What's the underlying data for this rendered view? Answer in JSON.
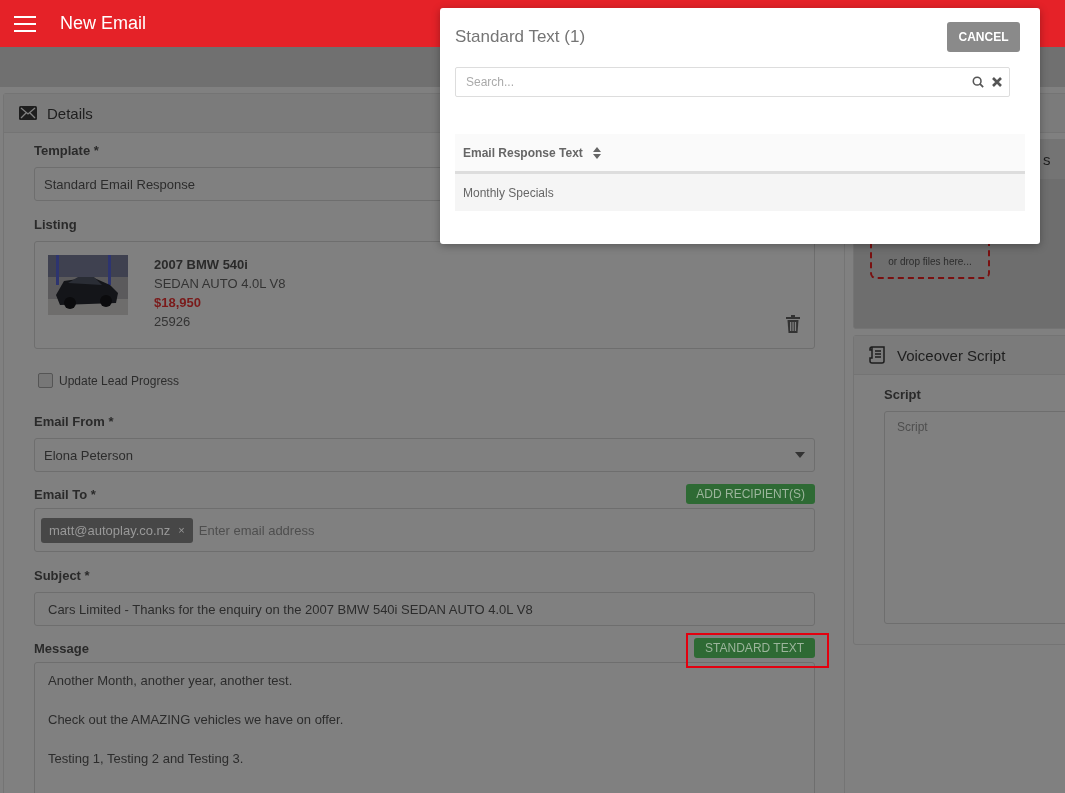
{
  "header": {
    "title": "New Email"
  },
  "details": {
    "title": "Details",
    "template": {
      "label": "Template *",
      "value": "Standard Email Response"
    },
    "listing": {
      "label": "Listing",
      "title": "2007 BMW 540i",
      "subtitle": "SEDAN AUTO 4.0L V8",
      "price": "$18,950",
      "stock": "25926"
    },
    "update_lead_progress": {
      "label": "Update Lead Progress",
      "checked": false
    },
    "email_from": {
      "label": "Email From *",
      "value": "Elona Peterson"
    },
    "email_to": {
      "label": "Email To *",
      "button": "ADD RECIPIENT(S)",
      "recipients": [
        {
          "address": "matt@autoplay.co.nz",
          "remove": "×"
        }
      ],
      "placeholder": "Enter email address"
    },
    "subject": {
      "label": "Subject *",
      "value": "Cars Limited - Thanks for the enquiry on the 2007 BMW 540i SEDAN AUTO 4.0L V8"
    },
    "message": {
      "label": "Message",
      "button": "STANDARD TEXT",
      "highlighted": true,
      "lines": [
        "Another Month, another year, another test.",
        "Check out the AMAZING vehicles we have on offer.",
        "Testing 1, Testing 2 and Testing 3."
      ]
    }
  },
  "side": {
    "upload_panel_title": "s",
    "drop_hint": "or drop files here...",
    "voiceover": {
      "title": "Voiceover Script",
      "script_label": "Script",
      "placeholder": "Script"
    }
  },
  "modal": {
    "title": "Standard Text (1)",
    "cancel": "CANCEL",
    "search": {
      "placeholder": "Search..."
    },
    "table": {
      "columns": [
        "Email Response Text"
      ],
      "rows": [
        [
          "Monthly Specials"
        ]
      ]
    }
  }
}
